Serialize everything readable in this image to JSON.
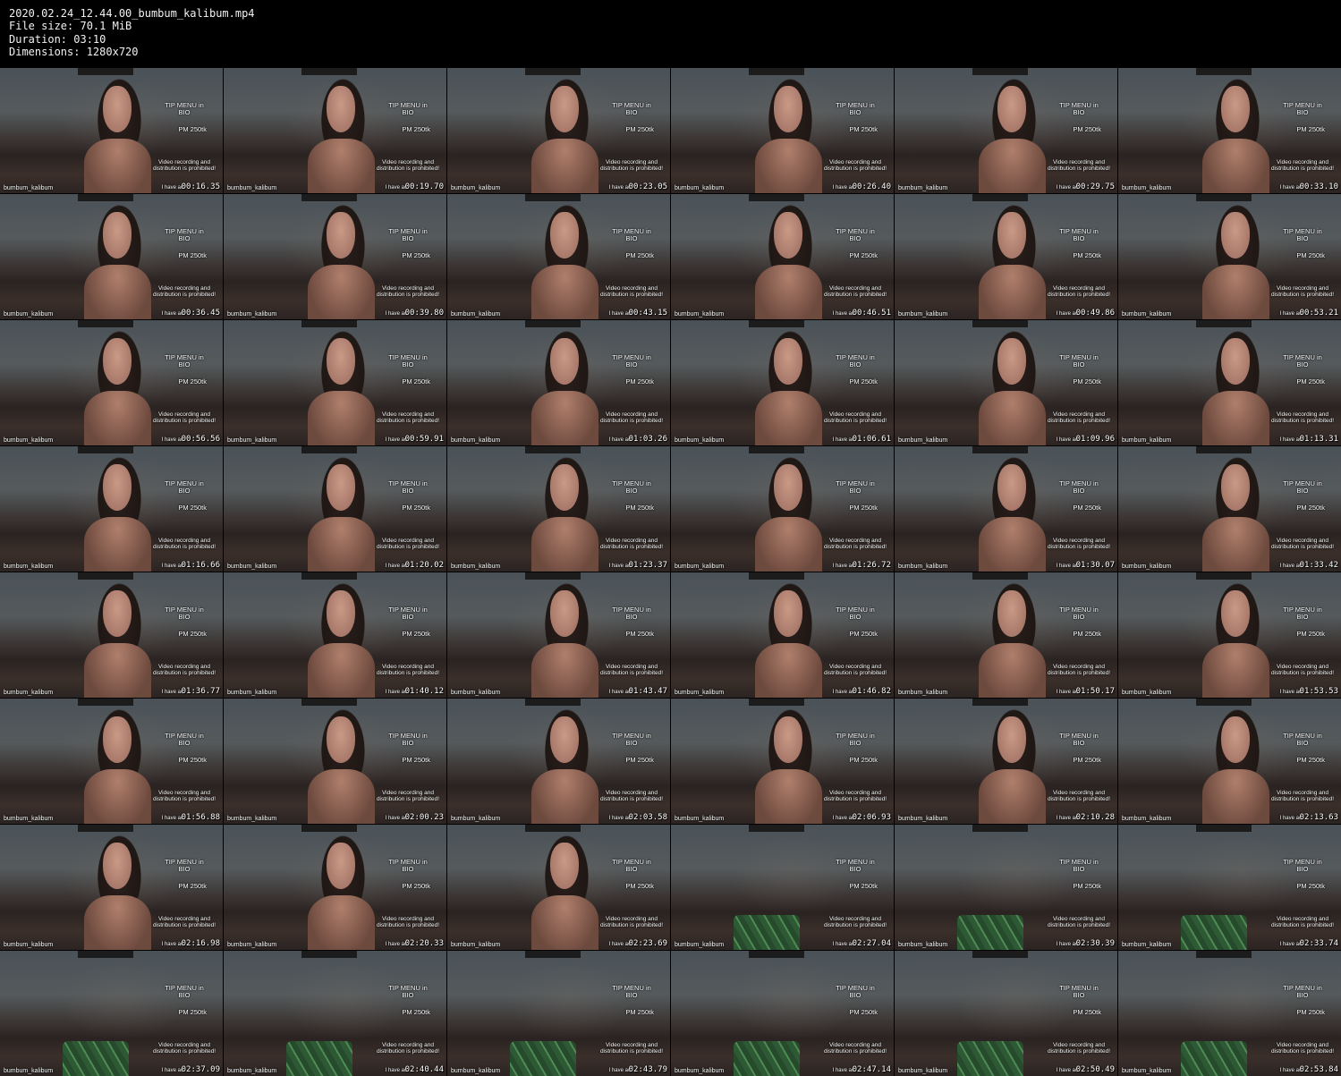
{
  "header": {
    "filename": "2020.02.24_12.44.00_bumbum_kalibum.mp4",
    "filesize": "File size: 70.1 MiB",
    "duration": "Duration: 03:10",
    "dimensions": "Dimensions: 1280x720"
  },
  "overlay": {
    "tip_menu": "TIP MENU in BIO",
    "pm": "PM 250tk",
    "recording": "Video recording and distribution is prohibited!",
    "username": "bumbum_kalibum",
    "have": "I have ac"
  },
  "thumbnails": [
    {
      "time": "00:16.35",
      "scene": "person"
    },
    {
      "time": "00:19.70",
      "scene": "person"
    },
    {
      "time": "00:23.05",
      "scene": "person"
    },
    {
      "time": "00:26.40",
      "scene": "person"
    },
    {
      "time": "00:29.75",
      "scene": "person"
    },
    {
      "time": "00:33.10",
      "scene": "person"
    },
    {
      "time": "00:36.45",
      "scene": "person"
    },
    {
      "time": "00:39.80",
      "scene": "person"
    },
    {
      "time": "00:43.15",
      "scene": "person"
    },
    {
      "time": "00:46.51",
      "scene": "person"
    },
    {
      "time": "00:49.86",
      "scene": "person"
    },
    {
      "time": "00:53.21",
      "scene": "person"
    },
    {
      "time": "00:56.56",
      "scene": "person"
    },
    {
      "time": "00:59.91",
      "scene": "person"
    },
    {
      "time": "01:03.26",
      "scene": "person"
    },
    {
      "time": "01:06.61",
      "scene": "person"
    },
    {
      "time": "01:09.96",
      "scene": "person"
    },
    {
      "time": "01:13.31",
      "scene": "person"
    },
    {
      "time": "01:16.66",
      "scene": "person"
    },
    {
      "time": "01:20.02",
      "scene": "person"
    },
    {
      "time": "01:23.37",
      "scene": "person"
    },
    {
      "time": "01:26.72",
      "scene": "person"
    },
    {
      "time": "01:30.07",
      "scene": "person"
    },
    {
      "time": "01:33.42",
      "scene": "person"
    },
    {
      "time": "01:36.77",
      "scene": "person"
    },
    {
      "time": "01:40.12",
      "scene": "person"
    },
    {
      "time": "01:43.47",
      "scene": "person"
    },
    {
      "time": "01:46.82",
      "scene": "person"
    },
    {
      "time": "01:50.17",
      "scene": "person"
    },
    {
      "time": "01:53.53",
      "scene": "person"
    },
    {
      "time": "01:56.88",
      "scene": "person"
    },
    {
      "time": "02:00.23",
      "scene": "person"
    },
    {
      "time": "02:03.58",
      "scene": "person"
    },
    {
      "time": "02:06.93",
      "scene": "person"
    },
    {
      "time": "02:10.28",
      "scene": "person"
    },
    {
      "time": "02:13.63",
      "scene": "person"
    },
    {
      "time": "02:16.98",
      "scene": "person"
    },
    {
      "time": "02:20.33",
      "scene": "person"
    },
    {
      "time": "02:23.69",
      "scene": "person"
    },
    {
      "time": "02:27.04",
      "scene": "plant"
    },
    {
      "time": "02:30.39",
      "scene": "plant"
    },
    {
      "time": "02:33.74",
      "scene": "plant"
    },
    {
      "time": "02:37.09",
      "scene": "plant"
    },
    {
      "time": "02:40.44",
      "scene": "plant"
    },
    {
      "time": "02:43.79",
      "scene": "plant"
    },
    {
      "time": "02:47.14",
      "scene": "plant"
    },
    {
      "time": "02:50.49",
      "scene": "plant"
    },
    {
      "time": "02:53.84",
      "scene": "plant"
    }
  ]
}
